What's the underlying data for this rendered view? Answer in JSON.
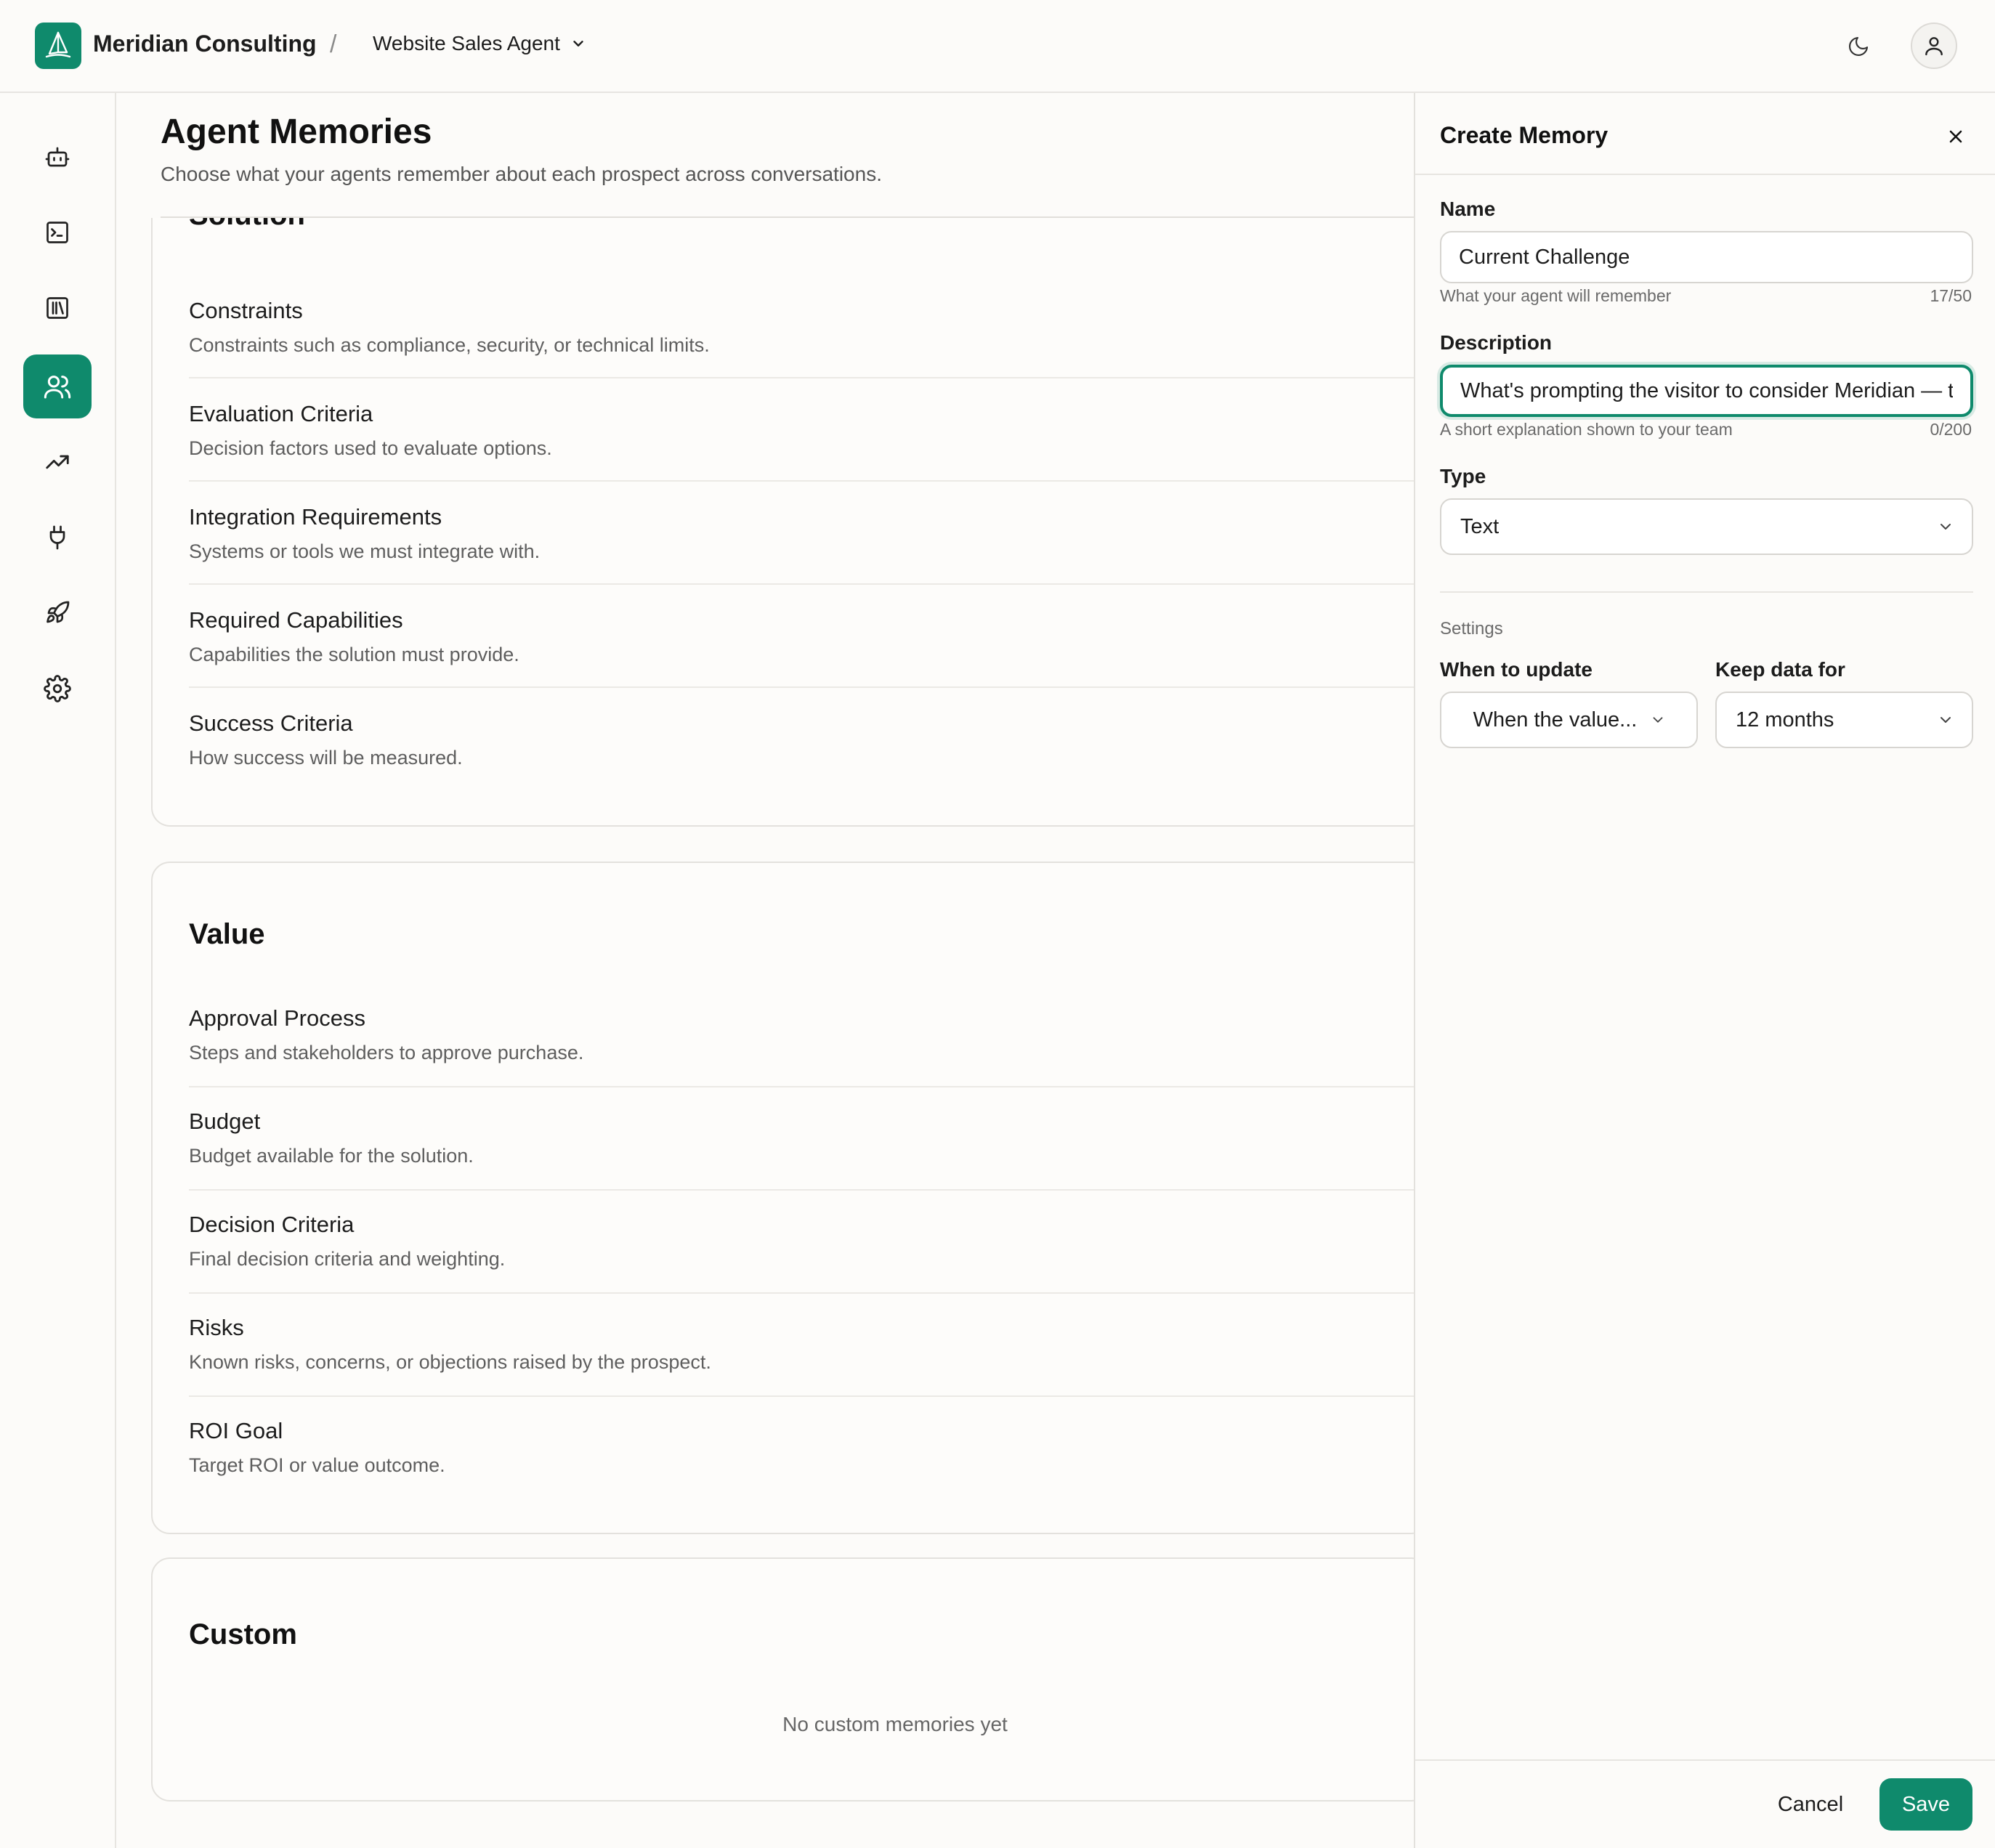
{
  "header": {
    "org_name": "Meridian Consulting",
    "separator": "/",
    "agent_name": "Website Sales Agent"
  },
  "sidebar": {
    "items": [
      {
        "icon": "bot-icon",
        "active": false
      },
      {
        "icon": "terminal-icon",
        "active": false
      },
      {
        "icon": "library-icon",
        "active": false
      },
      {
        "icon": "users-icon",
        "active": true
      },
      {
        "icon": "trending-up-icon",
        "active": false
      },
      {
        "icon": "plug-icon",
        "active": false
      },
      {
        "icon": "rocket-icon",
        "active": false
      },
      {
        "icon": "gear-icon",
        "active": false
      }
    ]
  },
  "main": {
    "title": "Agent Memories",
    "subtitle": "Choose what your agents remember about each prospect across conversations.",
    "partial_section_title": "Solution",
    "solution_rows": [
      {
        "label": "Constraints",
        "desc": "Constraints such as compliance, security, or technical limits."
      },
      {
        "label": "Evaluation Criteria",
        "desc": "Decision factors used to evaluate options."
      },
      {
        "label": "Integration Requirements",
        "desc": "Systems or tools we must integrate with."
      },
      {
        "label": "Required Capabilities",
        "desc": "Capabilities the solution must provide."
      },
      {
        "label": "Success Criteria",
        "desc": "How success will be measured."
      }
    ],
    "value_section": {
      "title": "Value",
      "rows": [
        {
          "label": "Approval Process",
          "desc": "Steps and stakeholders to approve purchase."
        },
        {
          "label": "Budget",
          "desc": "Budget available for the solution."
        },
        {
          "label": "Decision Criteria",
          "desc": "Final decision criteria and weighting."
        },
        {
          "label": "Risks",
          "desc": "Known risks, concerns, or objections raised by the prospect."
        },
        {
          "label": "ROI Goal",
          "desc": "Target ROI or value outcome."
        }
      ]
    },
    "custom_section": {
      "title": "Custom",
      "empty_text": "No custom memories yet"
    }
  },
  "drawer": {
    "title": "Create Memory",
    "name_label": "Name",
    "name_value": "Current Challenge",
    "name_hint": "What your agent will remember",
    "name_count": "17/50",
    "desc_label": "Description",
    "desc_value": "What's prompting the visitor to consider Meridian — the",
    "desc_hint": "A short explanation shown to your team",
    "desc_count": "0/200",
    "type_label": "Type",
    "type_value": "Text",
    "settings_label": "Settings",
    "update_label": "When to update",
    "update_value": "When the value...",
    "keep_label": "Keep data for",
    "keep_value": "12 months",
    "cancel_label": "Cancel",
    "save_label": "Save"
  },
  "colors": {
    "accent": "#0f8a6c",
    "background": "#fcfbf9",
    "border": "#e3e1dd"
  }
}
